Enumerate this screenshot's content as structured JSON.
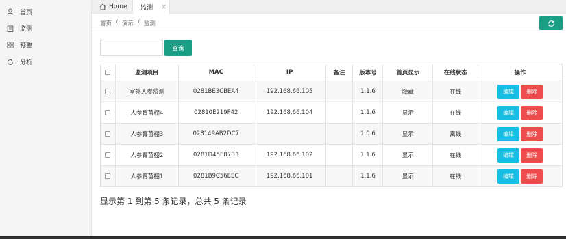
{
  "sidebar": {
    "items": [
      {
        "label": "首页",
        "icon": "user-icon"
      },
      {
        "label": "监测",
        "icon": "clipboard-icon"
      },
      {
        "label": "预警",
        "icon": "grid-icon"
      },
      {
        "label": "分析",
        "icon": "refresh-icon"
      }
    ]
  },
  "tabs": {
    "home": "Home",
    "monitor": "监测",
    "close_glyph": "×"
  },
  "breadcrumb": [
    "首页",
    "/",
    "演示",
    "/",
    "监测"
  ],
  "search": {
    "placeholder": "",
    "value": "",
    "button_label": "查询"
  },
  "table": {
    "headers": [
      "监测项目",
      "MAC",
      "IP",
      "备注",
      "版本号",
      "首页显示",
      "在线状态",
      "操作"
    ],
    "rows": [
      {
        "name": "室外人参监测",
        "mac": "0281BE3CBEA4",
        "ip": "192.168.66.105",
        "note": "",
        "version": "1.1.6",
        "home_display": "隐藏",
        "status": "在线"
      },
      {
        "name": "人参育苗棚4",
        "mac": "02810E219F42",
        "ip": "192.168.66.104",
        "note": "",
        "version": "1.1.6",
        "home_display": "显示",
        "status": "在线"
      },
      {
        "name": "人参育苗棚3",
        "mac": "028149AB2DC7",
        "ip": "",
        "note": "",
        "version": "1.0.6",
        "home_display": "显示",
        "status": "离线"
      },
      {
        "name": "人参育苗棚2",
        "mac": "0281D45E87B3",
        "ip": "192.168.66.102",
        "note": "",
        "version": "1.1.6",
        "home_display": "显示",
        "status": "在线"
      },
      {
        "name": "人参育苗棚1",
        "mac": "0281B9C56EEC",
        "ip": "192.168.66.101",
        "note": "",
        "version": "1.1.6",
        "home_display": "显示",
        "status": "在线"
      }
    ],
    "edit_label": "编辑",
    "delete_label": "删除"
  },
  "pagination_text": "显示第 1 到第 5 条记录，总共 5 条记录",
  "colors": {
    "primary": "#1a9e86",
    "edit": "#17bee3",
    "delete": "#ee4c4c"
  }
}
